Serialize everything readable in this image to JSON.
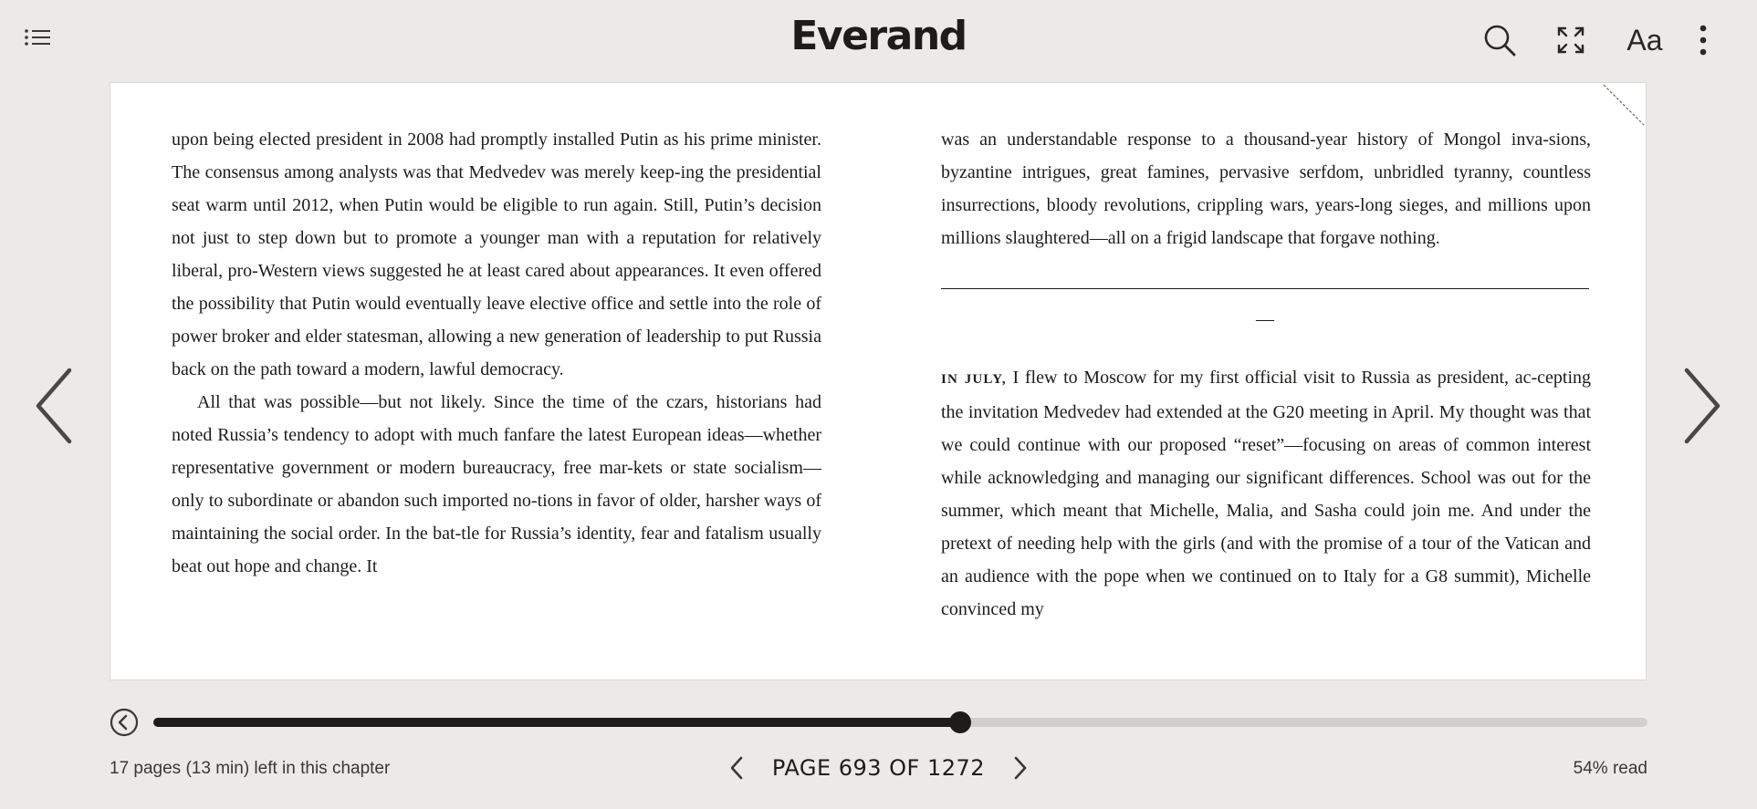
{
  "app": {
    "logo": "Everand"
  },
  "toolbar": {
    "menu_icon": "list-icon",
    "search_icon": "search-icon",
    "fullscreen_icon": "expand-icon",
    "font_settings_label": "Aa",
    "more_icon": "more-vertical-icon"
  },
  "book": {
    "left_page": {
      "paragraphs": [
        "upon being elected president in 2008 had promptly installed Putin as his prime minister. The consensus among analysts was that Medvedev was merely keep-ing the presidential seat warm until 2012, when Putin would be eligible to run again. Still, Putin’s decision not just to step down but to promote a younger man with a reputation for relatively liberal, pro-Western views suggested he at least cared about appearances. It even offered the possibility that Putin would eventually leave elective office and settle into the role of power broker and elder statesman, allowing a new generation of leadership to put Russia back on the path toward a modern, lawful democracy.",
        "All that was possible—but not likely. Since the time of the czars, historians had noted Russia’s tendency to adopt with much fanfare the latest European ideas—whether representative government or modern bureaucracy, free mar-kets or state socialism—only to subordinate or abandon such imported no-tions in favor of older, harsher ways of maintaining the social order. In the bat-tle for Russia’s identity, fear and fatalism usually beat out hope and change. It"
      ]
    },
    "right_page": {
      "continuation": "was an understandable response to a thousand-year history of Mongol inva-sions, byzantine intrigues, great famines, pervasive serfdom, unbridled tyranny, countless insurrections, bloody revolutions, crippling wars, years-long sieges, and millions upon millions slaughtered—all on a frigid landscape that forgave nothing.",
      "section_break": "—",
      "lead_in": "IN JULY,",
      "new_section": " I flew to Moscow for my first official visit to Russia as president, ac-cepting the invitation Medvedev had extended at the G20 meeting in April. My thought was that we could continue with our proposed “reset”—focusing on areas of common interest while acknowledging and managing our significant differences. School was out for the summer, which meant that Michelle, Malia, and Sasha could join me. And under the pretext of needing help with the girls (and with the promise of a tour of the Vatican and an audience with the pope when we continued on to Italy for a G8 summit), Michelle convinced my"
    }
  },
  "navigation": {
    "prev_icon": "chevron-left-icon",
    "next_icon": "chevron-right-icon"
  },
  "progress": {
    "fraction": 0.54,
    "back_icon": "back-circle-icon",
    "chapter_remaining": "17 pages (13 min) left in this chapter",
    "page_label": "PAGE 693 OF 1272",
    "percent_read": "54% read"
  },
  "colors": {
    "background": "#ebeae8",
    "page": "#ffffff",
    "ink": "#1e1c1a",
    "track": "#d2d0cc"
  }
}
